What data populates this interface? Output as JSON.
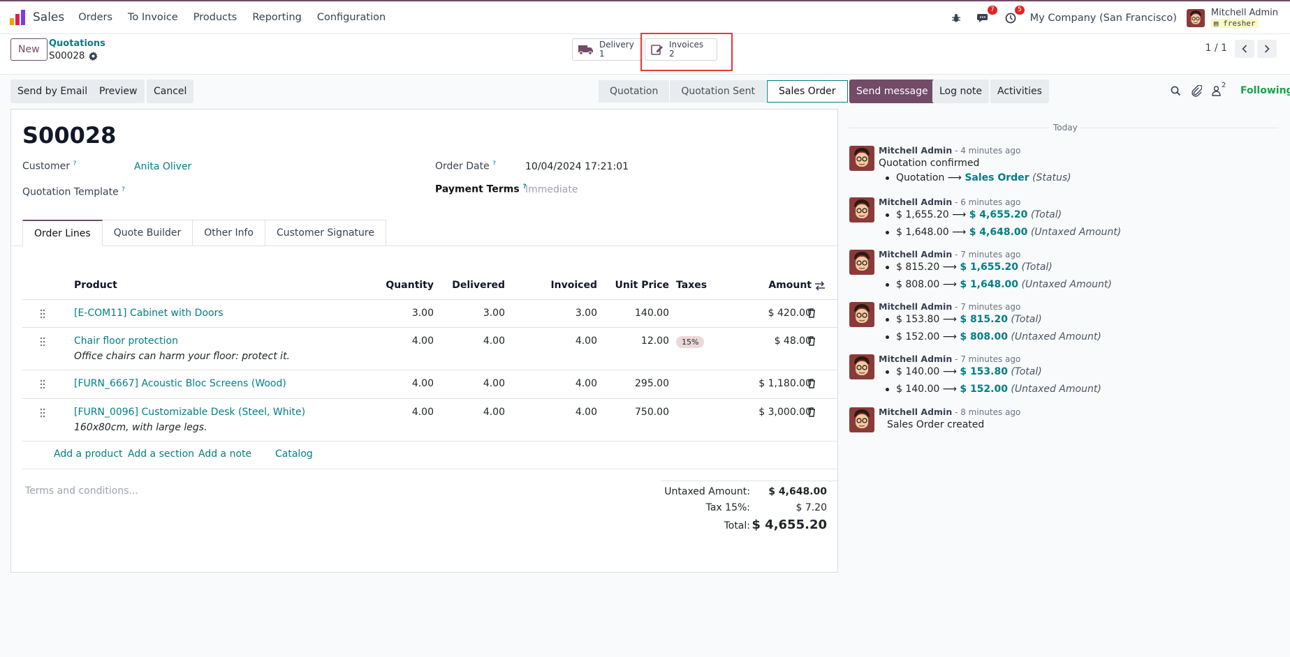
{
  "topbar": {
    "app_name": "Sales",
    "menu": [
      "Orders",
      "To Invoice",
      "Products",
      "Reporting",
      "Configuration"
    ],
    "messages_count": "7",
    "activities_count": "5",
    "company": "My Company (San Francisco)",
    "user_name": "Mitchell Admin",
    "user_db": "fresher"
  },
  "control": {
    "new_label": "New",
    "breadcrumb_parent": "Quotations",
    "breadcrumb_current": "S00028",
    "smart_buttons": [
      {
        "label": "Delivery",
        "count": "1"
      },
      {
        "label": "Invoices",
        "count": "2"
      }
    ],
    "pager": "1 / 1"
  },
  "actions": {
    "send_email": "Send by Email",
    "preview": "Preview",
    "cancel": "Cancel"
  },
  "statusbar": [
    "Quotation",
    "Quotation Sent",
    "Sales Order"
  ],
  "form": {
    "title": "S00028",
    "customer_label": "Customer",
    "customer": "Anita Oliver",
    "template_label": "Quotation Template",
    "order_date_label": "Order Date",
    "order_date": "10/04/2024 17:21:01",
    "payment_terms_label": "Payment Terms",
    "payment_terms": "Immediate",
    "tabs": [
      "Order Lines",
      "Quote Builder",
      "Other Info",
      "Customer Signature"
    ],
    "columns": [
      "Product",
      "Quantity",
      "Delivered",
      "Invoiced",
      "Unit Price",
      "Taxes",
      "Amount"
    ],
    "lines": [
      {
        "product": "[E-COM11] Cabinet with Doors",
        "desc": "",
        "qty": "3.00",
        "delivered": "3.00",
        "invoiced": "3.00",
        "price": "140.00",
        "tax": "",
        "amount": "$ 420.00"
      },
      {
        "product": "Chair floor protection",
        "desc": "Office chairs can harm your floor: protect it.",
        "qty": "4.00",
        "delivered": "4.00",
        "invoiced": "4.00",
        "price": "12.00",
        "tax": "15%",
        "amount": "$ 48.00"
      },
      {
        "product": "[FURN_6667] Acoustic Bloc Screens (Wood)",
        "desc": "",
        "qty": "4.00",
        "delivered": "4.00",
        "invoiced": "4.00",
        "price": "295.00",
        "tax": "",
        "amount": "$ 1,180.00"
      },
      {
        "product": "[FURN_0096] Customizable Desk (Steel, White)",
        "desc": "160x80cm, with large legs.",
        "qty": "4.00",
        "delivered": "4.00",
        "invoiced": "4.00",
        "price": "750.00",
        "tax": "",
        "amount": "$ 3,000.00"
      }
    ],
    "add_product": "Add a product",
    "add_section": "Add a section",
    "add_note": "Add a note",
    "catalog": "Catalog",
    "terms_placeholder": "Terms and conditions...",
    "untaxed_label": "Untaxed Amount:",
    "untaxed": "$ 4,648.00",
    "tax_label": "Tax 15%:",
    "tax": "$ 7.20",
    "total_label": "Total:",
    "total": "$ 4,655.20"
  },
  "chatter": {
    "send_message": "Send message",
    "log_note": "Log note",
    "activities": "Activities",
    "followers_count": "2",
    "following": "Following",
    "today": "Today",
    "messages": [
      {
        "author": "Mitchell Admin",
        "ago": "- 4 minutes ago",
        "body": "Quotation confirmed",
        "changes": [
          {
            "old": "Quotation",
            "new": "Sales Order",
            "field": "(Status)"
          }
        ]
      },
      {
        "author": "Mitchell Admin",
        "ago": "- 6 minutes ago",
        "body": "",
        "changes": [
          {
            "old": "$ 1,655.20",
            "new": "$ 4,655.20",
            "field": "(Total)"
          },
          {
            "old": "$ 1,648.00",
            "new": "$ 4,648.00",
            "field": "(Untaxed Amount)"
          }
        ]
      },
      {
        "author": "Mitchell Admin",
        "ago": "- 7 minutes ago",
        "body": "",
        "changes": [
          {
            "old": "$ 815.20",
            "new": "$ 1,655.20",
            "field": "(Total)"
          },
          {
            "old": "$ 808.00",
            "new": "$ 1,648.00",
            "field": "(Untaxed Amount)"
          }
        ]
      },
      {
        "author": "Mitchell Admin",
        "ago": "- 7 minutes ago",
        "body": "",
        "changes": [
          {
            "old": "$ 153.80",
            "new": "$ 815.20",
            "field": "(Total)"
          },
          {
            "old": "$ 152.00",
            "new": "$ 808.00",
            "field": "(Untaxed Amount)"
          }
        ]
      },
      {
        "author": "Mitchell Admin",
        "ago": "- 7 minutes ago",
        "body": "",
        "changes": [
          {
            "old": "$ 140.00",
            "new": "$ 153.80",
            "field": "(Total)"
          },
          {
            "old": "$ 140.00",
            "new": "$ 152.00",
            "field": "(Untaxed Amount)"
          }
        ]
      },
      {
        "author": "Mitchell Admin",
        "ago": "- 8 minutes ago",
        "body": "Sales Order created",
        "changes": []
      }
    ]
  },
  "colors": {
    "brand": "#714b67",
    "link": "#017e84",
    "highlight": "#e53935",
    "following": "#16a34a"
  }
}
